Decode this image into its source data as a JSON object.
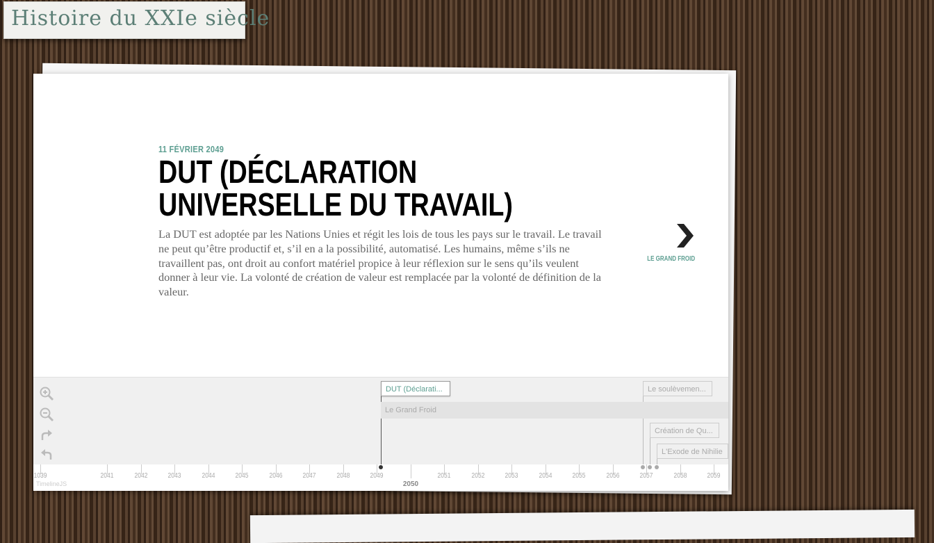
{
  "site": {
    "title": "Histoire du XXIe siècle"
  },
  "slide": {
    "date": "11 FÉVRIER 2049",
    "headline": "DUT (Déclaration universelle du travail)",
    "text": "La DUT est adoptée par les Nations Unies et régit les lois de tous les pays sur le travail. Le travail ne peut qu’être productif et, s’il en a la possibilité, automatisé. Les humains, même s’ils ne travaillent pas, ont droit au confort matériel propice à leur réflexion sur le sens qu’ils veulent donner à leur vie. La volonté de création de valeur est remplacée par la volonté de définition de la valeur.",
    "next_label": "LE GRAND FROID"
  },
  "timenav": {
    "tools": [
      "zoom-in-icon",
      "zoom-out-icon",
      "redo-icon",
      "undo-icon"
    ],
    "markers": {
      "active": "DUT (Déclarati...",
      "m2": "Le soulèvemen...",
      "m3": "Création de Qu...",
      "m4": "L'Exode de Nihilie"
    },
    "era": "Le Grand Froid",
    "axis": {
      "years": [
        "1039",
        "2041",
        "2042",
        "2043",
        "2044",
        "2045",
        "2046",
        "2047",
        "2048",
        "2049",
        "2051",
        "2052",
        "2053",
        "2054",
        "2055",
        "2056",
        "2057",
        "2058",
        "2059"
      ],
      "major": "2050"
    },
    "credit": "TimelineJS"
  },
  "colors": {
    "accent": "#5e9f92",
    "title": "#5c7f76"
  }
}
